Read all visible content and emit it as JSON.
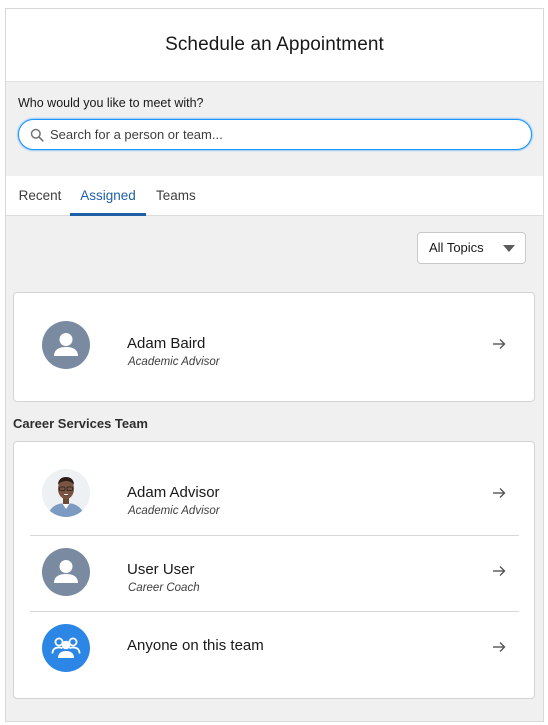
{
  "header": {
    "title": "Schedule an Appointment"
  },
  "search": {
    "label": "Who would you like to meet with?",
    "placeholder": "Search for a person or team...",
    "value": ""
  },
  "tabs": [
    {
      "label": "Recent",
      "active": false
    },
    {
      "label": "Assigned",
      "active": true
    },
    {
      "label": "Teams",
      "active": false
    }
  ],
  "filter": {
    "selected": "All Topics"
  },
  "assigned": {
    "name": "Adam Baird",
    "role": "Academic Advisor",
    "avatar_icon": "user-icon"
  },
  "team": {
    "title": "Career Services Team",
    "members": [
      {
        "name": "Adam Advisor",
        "role": "Academic Advisor",
        "avatar_icon": "photo-avatar"
      },
      {
        "name": "User User",
        "role": "Career Coach",
        "avatar_icon": "user-icon"
      },
      {
        "name": "Anyone on this team",
        "role": "",
        "avatar_icon": "group-icon"
      }
    ]
  },
  "colors": {
    "accent": "#1f5fa6",
    "focus_ring": "#1b96ff",
    "avatar_grey": "#7a8aa0",
    "team_blue": "#2b86e6"
  }
}
